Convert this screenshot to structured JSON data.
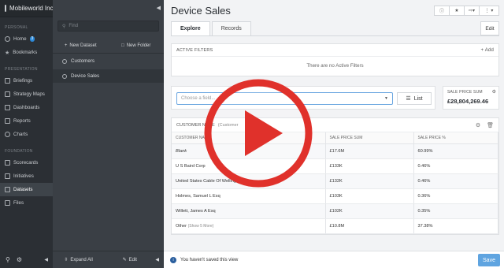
{
  "brand": {
    "name": "Mobileworld Inc. Example"
  },
  "sidebar": {
    "sections": [
      {
        "label": "Personal",
        "items": [
          {
            "label": "Home",
            "badge": "3"
          },
          {
            "label": "Bookmarks"
          }
        ]
      },
      {
        "label": "Presentation",
        "items": [
          {
            "label": "Briefings"
          },
          {
            "label": "Strategy Maps"
          },
          {
            "label": "Dashboards"
          },
          {
            "label": "Reports"
          },
          {
            "label": "Charts"
          }
        ]
      },
      {
        "label": "Foundation",
        "items": [
          {
            "label": "Scorecards"
          },
          {
            "label": "Initiatives"
          },
          {
            "label": "Datasets",
            "active": true
          },
          {
            "label": "Files"
          }
        ]
      }
    ]
  },
  "panel": {
    "search_placeholder": "Find",
    "new_dataset": "New Dataset",
    "new_folder": "New Folder",
    "items": [
      {
        "label": "Customers"
      },
      {
        "label": "Device Sales",
        "active": true
      }
    ],
    "expand_all": "Expand All",
    "edit": "Edit"
  },
  "main": {
    "title": "Device Sales",
    "tabs": [
      {
        "label": "Explore",
        "active": true
      },
      {
        "label": "Records"
      }
    ],
    "edit_label": "Edit",
    "filters": {
      "header": "Active Filters",
      "add_label": "Add",
      "empty": "There are no Active Filters"
    },
    "field_select": {
      "placeholder": "Choose a field...",
      "list_label": "List"
    },
    "sum_card": {
      "label": "Sale Price Sum",
      "value": "£28,804,269.46"
    },
    "table": {
      "title": "Customer Name",
      "subtitle": "(Customer",
      "columns": [
        "Customer Name",
        "Sale Price Sum",
        "Sale Price %"
      ],
      "rows": [
        {
          "name": "Blank",
          "sum": "£17.6M",
          "pct": "60.99%"
        },
        {
          "name": "U S Baird Corp",
          "sum": "£133K",
          "pct": "0.46%"
        },
        {
          "name": "United States Cable Of Wellington",
          "sum": "£132K",
          "pct": "0.46%"
        },
        {
          "name": "Holmes, Samuel L Esq",
          "sum": "£103K",
          "pct": "0.36%"
        },
        {
          "name": "Willett, James A Esq",
          "sum": "£102K",
          "pct": "0.35%"
        },
        {
          "name": "Other",
          "note": "(Show 5 More)",
          "sum": "£10.8M",
          "pct": "37.38%"
        }
      ]
    }
  },
  "footer": {
    "message": "You haven't saved this view",
    "save_label": "Save"
  },
  "colors": {
    "accent": "#2d8ad9",
    "play_red": "#e0312b",
    "sidebar_bg": "#2b2f34",
    "panel_bg": "#3a3f45"
  }
}
